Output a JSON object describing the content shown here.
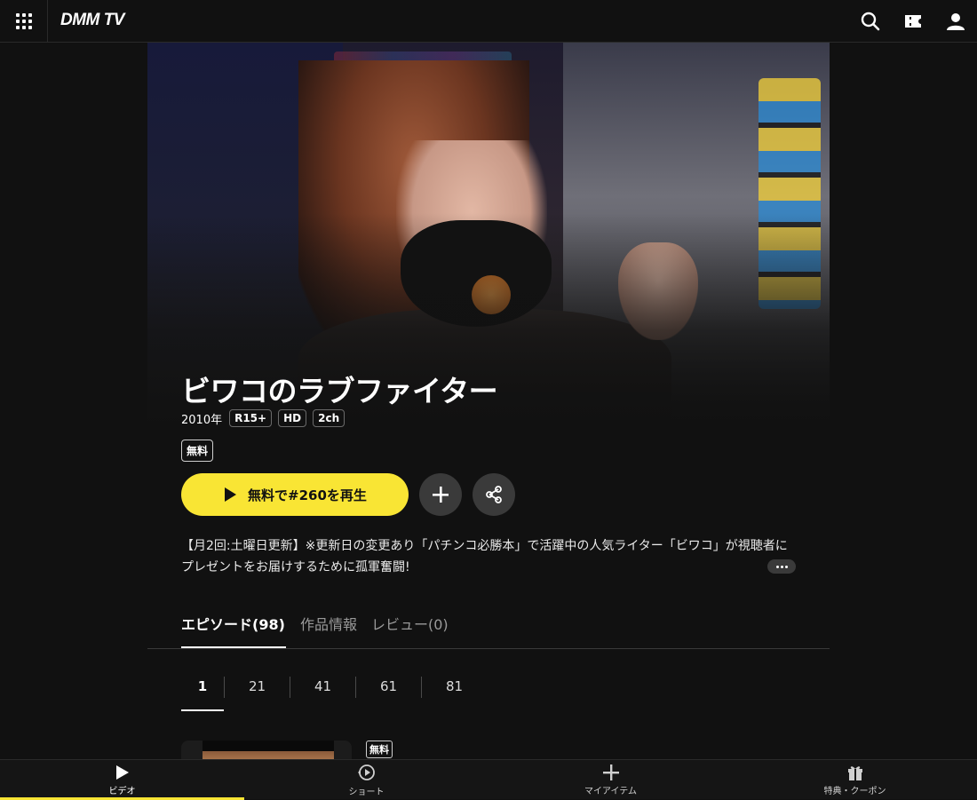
{
  "header": {
    "logo": "DMM TV",
    "icons": [
      "grid-menu-icon",
      "search-icon",
      "ticket-icon",
      "account-icon"
    ]
  },
  "title": {
    "name": "ビワコのラブファイター",
    "year": "2010年",
    "tags": [
      "R15+",
      "HD",
      "2ch"
    ],
    "free_badge": "無料"
  },
  "actions": {
    "play_label": "無料で#260を再生",
    "add_icon": "plus-icon",
    "share_icon": "share-icon"
  },
  "description": {
    "line1": "【月2回:土曜日更新】※更新日の変更あり「パチンコ必勝本」で活躍中の人気ライター「ビワコ」が視聴者に",
    "line2": "プレゼントをお届けするために孤軍奮闘!"
  },
  "tabs": [
    {
      "label": "エピソード(98)",
      "active": true
    },
    {
      "label": "作品情報",
      "active": false
    },
    {
      "label": "レビュー(0)",
      "active": false
    }
  ],
  "pages": [
    "1",
    "21",
    "41",
    "61",
    "81"
  ],
  "episode": {
    "free_badge": "無料"
  },
  "bottom_nav": [
    {
      "label": "ビデオ",
      "icon": "play-icon",
      "active": true
    },
    {
      "label": "ショート",
      "icon": "short-play-icon",
      "active": false
    },
    {
      "label": "マイアイテム",
      "icon": "plus-icon",
      "active": false
    },
    {
      "label": "特典・クーポン",
      "icon": "gift-icon",
      "active": false
    }
  ],
  "colors": {
    "accent": "#f9e534",
    "background": "#111111"
  }
}
